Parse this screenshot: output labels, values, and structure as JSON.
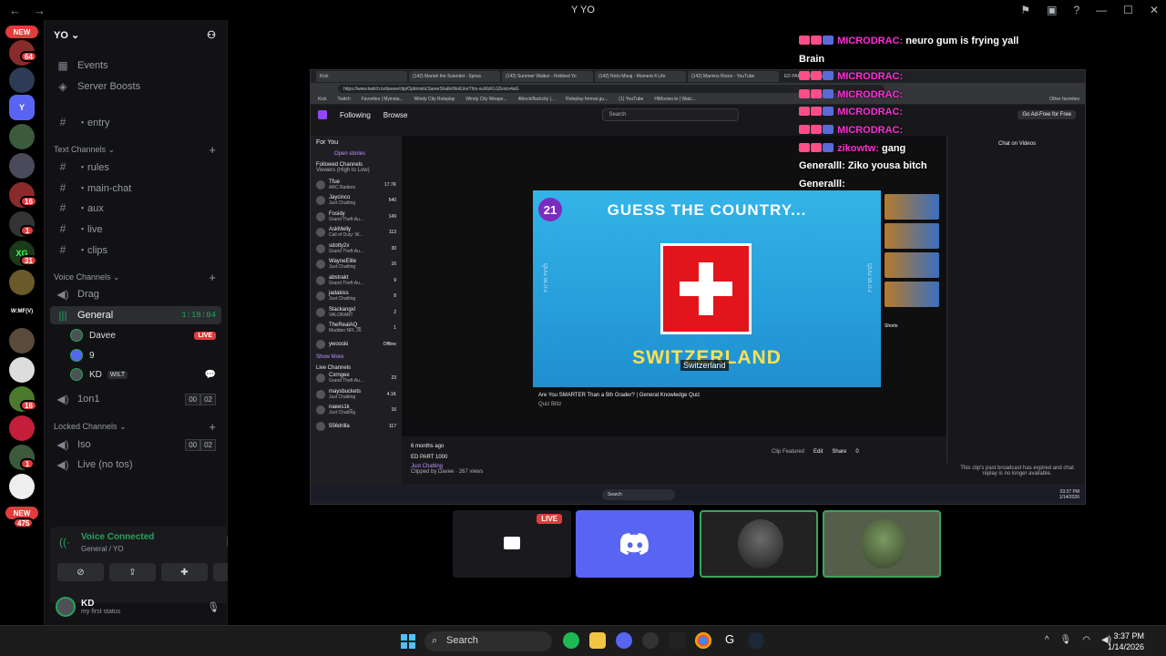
{
  "window": {
    "title": "YO"
  },
  "rail": {
    "new_label": "NEW",
    "badges": [
      "64",
      "16",
      "1",
      "31",
      "16",
      "1",
      "475"
    ],
    "labels": [
      "Y",
      "XG",
      "W:MF(V)"
    ]
  },
  "server": {
    "name": "YO",
    "events": "Events",
    "boosts": "Server Boosts",
    "entry": "・entry",
    "text_category": "Text Channels",
    "text_channels": [
      "・rules",
      "・main-chat",
      "・aux",
      "・live",
      "・clips"
    ],
    "voice_category": "Voice Channels",
    "drag": "Drag",
    "general": "General",
    "general_time": "1:18:04",
    "users": [
      {
        "name": "Davee",
        "badge": "LIVE"
      },
      {
        "name": "9"
      },
      {
        "name": "KD",
        "tag": "WILT"
      }
    ],
    "oneonone": "1on1",
    "oneonone_counts": [
      "00",
      "02"
    ],
    "locked_category": "Locked Channels",
    "iso": "Iso",
    "iso_counts": [
      "00",
      "02"
    ],
    "live_no_tos": "Live (no tos)"
  },
  "voice": {
    "status": "Voice Connected",
    "location": "General / YO"
  },
  "userbar": {
    "name": "KD",
    "status": "my first status"
  },
  "overlay_chat": [
    {
      "user": "MICRODRAC:",
      "msg": "neuro gum is frying yall",
      "user_color": "pink"
    },
    {
      "user": "",
      "msg": "Brain",
      "user_color": "white"
    },
    {
      "user": "MICRODRAC:",
      "msg": "",
      "user_color": "pink"
    },
    {
      "user": "MICRODRAC:",
      "msg": "",
      "user_color": "pink"
    },
    {
      "user": "MICRODRAC:",
      "msg": "",
      "user_color": "pink"
    },
    {
      "user": "MICRODRAC:",
      "msg": "",
      "user_color": "pink"
    },
    {
      "user": "zikowtw:",
      "msg": "gang",
      "user_color": "pink"
    },
    {
      "user": "Generalll:",
      "msg": "Ziko yousa bitch",
      "user_color": "white"
    },
    {
      "user": "Generalll:",
      "msg": "",
      "user_color": "white"
    }
  ],
  "stream": {
    "tabs": [
      "Kick",
      "(142) Mariah the Scientist - Sprea",
      "(142) Summer Walker - Robbed Yo",
      "(142) Nicki Minaj - Moment 4 Life",
      "(142) Marvins Room - YouTube",
      "ED PART 1000 - Twitch"
    ],
    "url": "https://www.twitch.tv/davee/clip/OptimisticSameShallotNotLikeThis-xuWzKLG5oicn4aG",
    "bookmarks": [
      "Kick",
      "Twitch",
      "Favorites | Myinsta...",
      "Windy City Roleplay",
      "Windy City Weapo...",
      "4block/flackcity |...",
      "Roleplay format gu...",
      "(1) YouTube",
      "HiMovies.to | Watc...",
      "Other favorites"
    ],
    "twitch_nav": [
      "Following",
      "Browse"
    ],
    "search": "Search",
    "ad_free": "Go Ad-Free for Free",
    "for_you": "For You",
    "open_stories": "Open stories",
    "followed": "Followed Channels",
    "followed_sub": "Viewers (High to Low)",
    "channels": [
      {
        "name": "Tfue",
        "game": "ARC Raiders",
        "count": "17.7K"
      },
      {
        "name": "Jaycinco",
        "game": "Just Chatting",
        "count": "540"
      },
      {
        "name": "Fosidy",
        "game": "Grand Theft Au...",
        "count": "149"
      },
      {
        "name": "AskMelly",
        "game": "Call of Duty: W...",
        "count": "113"
      },
      {
        "name": "sdotty2x",
        "game": "Grand Theft Au...",
        "count": "30"
      },
      {
        "name": "WayneElite",
        "game": "Just Chatting",
        "count": "16"
      },
      {
        "name": "abstrakt",
        "game": "Grand Theft Au...",
        "count": "9"
      },
      {
        "name": "jadakiss",
        "game": "Just Chatting",
        "count": "8"
      },
      {
        "name": "Slackangxl",
        "game": "VALORANT",
        "count": "2"
      },
      {
        "name": "TheRealAQ_",
        "game": "Madden NFL 26",
        "count": "1"
      },
      {
        "name": "ywooski",
        "game": "",
        "count": "Offline"
      }
    ],
    "show_more": "Show More",
    "live_channels": "Live Channels",
    "live": [
      {
        "name": "Cxrngee",
        "game": "Grand Theft Au...",
        "count": "23"
      },
      {
        "name": "maysbuckets",
        "game": "Just Chatting",
        "count": "4.1K"
      },
      {
        "name": "naees1k_",
        "game": "Just Chatting",
        "count": "16"
      },
      {
        "name": "556drilla",
        "game": "",
        "count": "117"
      }
    ],
    "video": {
      "number": "21",
      "question": "GUESS THE COUNTRY...",
      "answer": "SWITZERLAND",
      "caption": "Switzerland",
      "side_text": "QUIZ BLITZ",
      "title": "Are You SMARTER Than a 5th Grader? | General Knowledge Quiz",
      "channel": "Quiz Blitz",
      "shorts": "Shorts"
    },
    "clip_age": "6 months ago",
    "clip_title": "ED PART 1000",
    "clip_cat": "Just Chatting",
    "clip_by": "Clipped by Davee · 267 views",
    "clip_featured": "Clip Featured",
    "edit": "Edit",
    "share": "Share",
    "likes": "0",
    "chat_title": "Chat on Videos",
    "chat_expired": "This clip's past broadcast has expired and chat replay is no longer available.",
    "inner_search": "Search",
    "inner_time": "03:37 PM",
    "inner_date": "1/14/2026"
  },
  "tiles": {
    "live": "LIVE"
  },
  "taskbar": {
    "search": "Search",
    "time": "3:37 PM",
    "date": "1/14/2026"
  }
}
